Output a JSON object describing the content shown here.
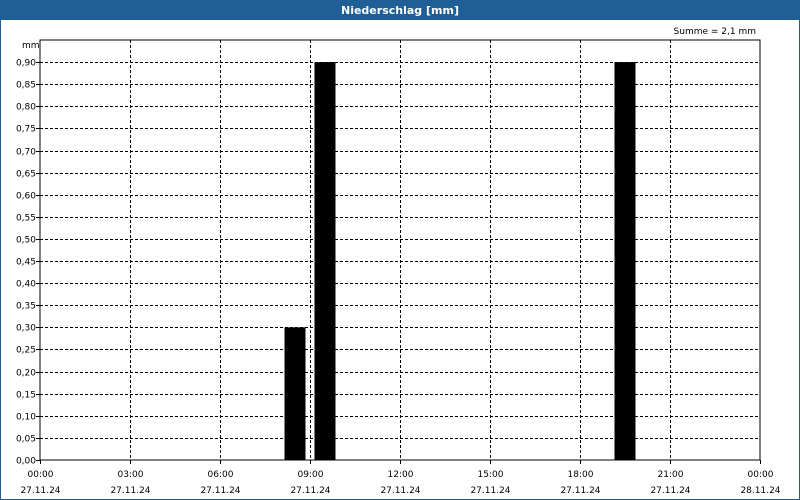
{
  "title": "Niederschlag [mm]",
  "summary": "Summe = 2,1 mm",
  "colors": {
    "header": "#1f5f95",
    "bars": "#000000",
    "grid": "#000000"
  },
  "chart_data": {
    "type": "bar",
    "title": "Niederschlag [mm]",
    "ylabel": "mm",
    "ylim": [
      0,
      0.95
    ],
    "yticks": [
      "0,00",
      "0,05",
      "0,10",
      "0,15",
      "0,20",
      "0,25",
      "0,30",
      "0,35",
      "0,40",
      "0,45",
      "0,50",
      "0,55",
      "0,60",
      "0,65",
      "0,70",
      "0,75",
      "0,80",
      "0,85",
      "0,90"
    ],
    "xlim": [
      "27.11.24 00:00",
      "28.11.24 00:00"
    ],
    "xticks": [
      {
        "time": "00:00",
        "date": "27.11.24"
      },
      {
        "time": "03:00",
        "date": "27.11.24"
      },
      {
        "time": "06:00",
        "date": "27.11.24"
      },
      {
        "time": "09:00",
        "date": "27.11.24"
      },
      {
        "time": "12:00",
        "date": "27.11.24"
      },
      {
        "time": "15:00",
        "date": "27.11.24"
      },
      {
        "time": "18:00",
        "date": "27.11.24"
      },
      {
        "time": "21:00",
        "date": "27.11.24"
      },
      {
        "time": "00:00",
        "date": "28.11.24"
      }
    ],
    "grid": true,
    "series": [
      {
        "color": "#000000",
        "points": [
          {
            "start": "27.11.24 08:00",
            "end": "27.11.24 09:00",
            "value": 0.3
          },
          {
            "start": "27.11.24 09:00",
            "end": "27.11.24 10:00",
            "value": 0.9
          },
          {
            "start": "27.11.24 19:00",
            "end": "27.11.24 20:00",
            "value": 0.9
          }
        ]
      }
    ]
  }
}
